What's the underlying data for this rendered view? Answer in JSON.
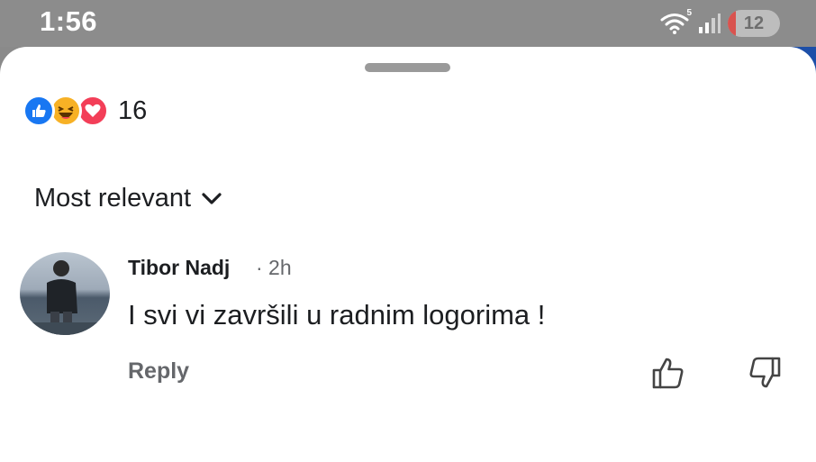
{
  "status_bar": {
    "time": "1:56",
    "battery_level": "12",
    "wifi_badge": "5",
    "icons": [
      "wifi-icon",
      "signal-icon",
      "battery-icon"
    ]
  },
  "reactions": {
    "types": [
      "like",
      "haha",
      "love"
    ],
    "count": "16"
  },
  "sort": {
    "label": "Most relevant",
    "icon": "chevron-down-icon"
  },
  "comment": {
    "author": "Tibor Nadj",
    "time": "· 2h",
    "text": "I svi vi završili u radnim logorima !",
    "reply_label": "Reply",
    "actions": [
      "thumb-up-icon",
      "thumb-down-icon"
    ]
  },
  "colors": {
    "status_bar": "#8c8c8c",
    "like_blue": "#1877f2",
    "haha_yellow": "#f7b125",
    "love_red": "#f33e58",
    "secondary_text": "#65676b",
    "primary_text": "#1c1e21"
  }
}
